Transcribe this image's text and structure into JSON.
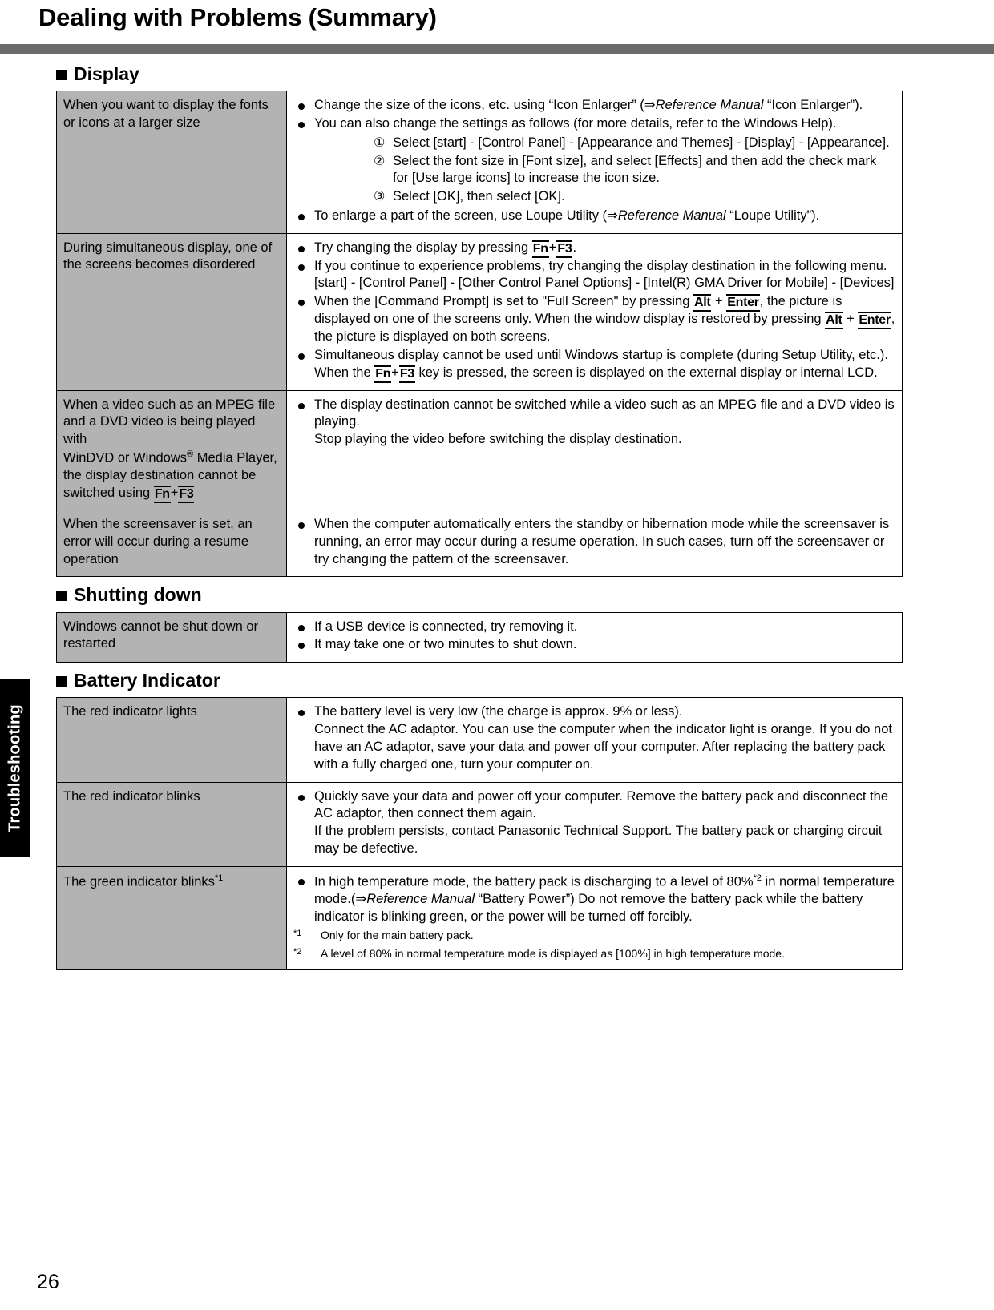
{
  "page": {
    "title": "Dealing with Problems (Summary)",
    "number": "26",
    "side_tab": "Troubleshooting"
  },
  "sections": [
    {
      "heading": "Display",
      "rows": [
        {
          "question": "When you want to display the fonts or icons at a larger size",
          "bullets": [
            {
              "parts": [
                {
                  "t": "text",
                  "v": "Change the size of the icons, etc. using “Icon Enlarger” (⇒"
                },
                {
                  "t": "ref",
                  "v": "Reference Manual"
                },
                {
                  "t": "text",
                  "v": " “Icon Enlarger”)."
                }
              ]
            },
            {
              "parts": [
                {
                  "t": "text",
                  "v": "You can also change the settings as follows (for more details, refer to the Windows Help)."
                }
              ],
              "steps": [
                {
                  "num": "①",
                  "text": "Select [start] - [Control Panel] - [Appearance and Themes] - [Display] - [Appearance]."
                },
                {
                  "num": "②",
                  "text": "Select the font size in [Font size], and select [Effects] and then add the check mark for [Use large icons] to increase the icon size."
                },
                {
                  "num": "③",
                  "text": "Select [OK], then select [OK]."
                }
              ]
            },
            {
              "parts": [
                {
                  "t": "text",
                  "v": "To enlarge a part of the screen, use Loupe Utility (⇒"
                },
                {
                  "t": "ref",
                  "v": "Reference Manual"
                },
                {
                  "t": "text",
                  "v": " “Loupe Utility”)."
                }
              ]
            }
          ]
        },
        {
          "question": "During simultaneous display, one of the screens becomes disordered",
          "bullets": [
            {
              "parts": [
                {
                  "t": "text",
                  "v": "Try changing the display by pressing "
                },
                {
                  "t": "key",
                  "v": "Fn"
                },
                {
                  "t": "text",
                  "v": "+"
                },
                {
                  "t": "key",
                  "v": "F3"
                },
                {
                  "t": "text",
                  "v": "."
                }
              ]
            },
            {
              "parts": [
                {
                  "t": "text",
                  "v": "If you continue to experience problems, try changing the display destination in the following menu."
                },
                {
                  "t": "br",
                  "v": ""
                },
                {
                  "t": "text",
                  "v": "[start] - [Control Panel] - [Other Control Panel Options] - [Intel(R) GMA Driver for Mobile] - [Devices]"
                }
              ]
            },
            {
              "parts": [
                {
                  "t": "text",
                  "v": "When the [Command Prompt] is set to \"Full Screen\" by pressing "
                },
                {
                  "t": "key",
                  "v": "Alt"
                },
                {
                  "t": "text",
                  "v": " + "
                },
                {
                  "t": "key",
                  "v": "Enter"
                },
                {
                  "t": "text",
                  "v": ", the picture is displayed on one of the screens only. When the window display is restored by pressing "
                },
                {
                  "t": "key",
                  "v": "Alt"
                },
                {
                  "t": "text",
                  "v": " + "
                },
                {
                  "t": "key",
                  "v": "Enter"
                },
                {
                  "t": "text",
                  "v": ", the picture is displayed on both screens."
                }
              ]
            },
            {
              "parts": [
                {
                  "t": "text",
                  "v": "Simultaneous display cannot be used until Windows startup is complete (during Setup Utility, etc.). When the "
                },
                {
                  "t": "key",
                  "v": "Fn"
                },
                {
                  "t": "text",
                  "v": "+"
                },
                {
                  "t": "key",
                  "v": "F3"
                },
                {
                  "t": "text",
                  "v": " key is pressed, the screen is displayed on the external display or internal LCD."
                }
              ]
            }
          ]
        },
        {
          "question_parts": [
            {
              "t": "text",
              "v": "When a video such as an MPEG file and a DVD video is being played with"
            },
            {
              "t": "br",
              "v": ""
            },
            {
              "t": "text",
              "v": "WinDVD or Windows"
            },
            {
              "t": "reg",
              "v": "®"
            },
            {
              "t": "text",
              "v": " Media Player, the display destination cannot be switched using "
            },
            {
              "t": "key",
              "v": "Fn"
            },
            {
              "t": "text",
              "v": "+"
            },
            {
              "t": "key",
              "v": "F3"
            }
          ],
          "bullets": [
            {
              "parts": [
                {
                  "t": "text",
                  "v": "The display destination cannot be switched while a video such as an MPEG file and a DVD video is playing."
                },
                {
                  "t": "br",
                  "v": ""
                },
                {
                  "t": "text",
                  "v": "Stop playing the video before switching the display destination."
                }
              ]
            }
          ]
        },
        {
          "question": "When the screensaver is set, an error will occur during a resume operation",
          "bullets": [
            {
              "parts": [
                {
                  "t": "text",
                  "v": "When the computer automatically enters the standby or hibernation mode while the screensaver is running, an error may occur during a resume operation. In such cases, turn off the screensaver or try changing the pattern of the screensaver."
                }
              ]
            }
          ]
        }
      ]
    },
    {
      "heading": "Shutting down",
      "rows": [
        {
          "question": "Windows cannot be shut down or restarted",
          "bullets": [
            {
              "parts": [
                {
                  "t": "text",
                  "v": "If a USB device is connected, try removing it."
                }
              ]
            },
            {
              "parts": [
                {
                  "t": "text",
                  "v": "It may take one or two minutes to shut down."
                }
              ]
            }
          ]
        }
      ]
    },
    {
      "heading": "Battery Indicator",
      "rows": [
        {
          "question": "The red indicator lights",
          "bullets": [
            {
              "parts": [
                {
                  "t": "text",
                  "v": "The battery level is very low (the charge is approx. 9% or less)."
                },
                {
                  "t": "br",
                  "v": ""
                },
                {
                  "t": "text",
                  "v": "Connect the AC adaptor. You can use the computer when the indicator light is orange. If you do not have an AC adaptor, save your data and power off your computer. After replacing the battery pack with a fully charged one, turn your computer on."
                }
              ]
            }
          ]
        },
        {
          "question": "The red indicator blinks",
          "bullets": [
            {
              "parts": [
                {
                  "t": "text",
                  "v": "Quickly save your data and power off your computer. Remove the battery pack and disconnect the AC adaptor, then connect them again."
                },
                {
                  "t": "br",
                  "v": ""
                },
                {
                  "t": "text",
                  "v": "If the problem persists, contact Panasonic Technical Support.  The battery pack or charging circuit may be defective."
                }
              ]
            }
          ]
        },
        {
          "question_parts": [
            {
              "t": "text",
              "v": "The green indicator blinks"
            },
            {
              "t": "fn",
              "v": "*1"
            }
          ],
          "bullets": [
            {
              "parts": [
                {
                  "t": "text",
                  "v": "In high temperature mode, the battery pack is discharging to a level of 80%"
                },
                {
                  "t": "fn",
                  "v": "*2"
                },
                {
                  "t": "text",
                  "v": " in normal temperature mode.(⇒"
                },
                {
                  "t": "ref",
                  "v": "Reference Manual"
                },
                {
                  "t": "text",
                  "v": " “Battery Power”) Do not remove the battery pack while the battery indicator is blinking green, or the power will be turned off forcibly."
                }
              ]
            }
          ],
          "notes": [
            {
              "mark": "*1",
              "text": "Only for the main battery pack."
            },
            {
              "mark": "*2",
              "text": "A level of 80% in normal temperature mode is displayed as [100%] in high temperature mode."
            }
          ]
        }
      ]
    }
  ]
}
